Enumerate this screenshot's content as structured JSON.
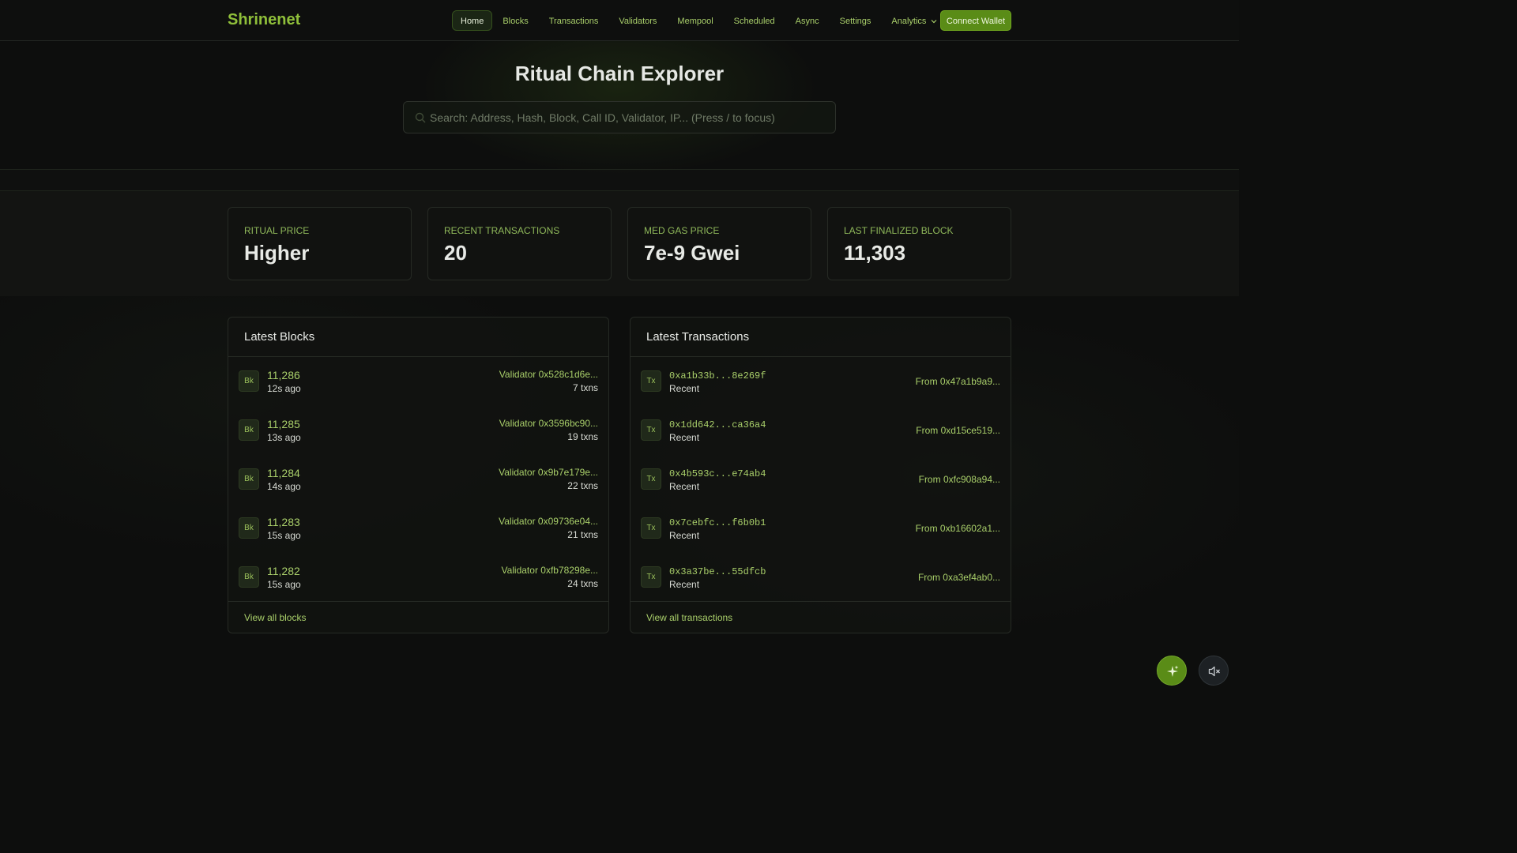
{
  "brand": "Shrinenet",
  "nav": {
    "links": [
      "Home",
      "Blocks",
      "Transactions",
      "Validators",
      "Mempool",
      "Scheduled",
      "Async",
      "Settings"
    ],
    "analytics": "Analytics",
    "connect_wallet": "Connect Wallet"
  },
  "hero": {
    "title": "Ritual Chain Explorer",
    "search_placeholder": "Search: Address, Hash, Block, Call ID, Validator, IP... (Press / to focus)"
  },
  "stats": [
    {
      "label": "RITUAL PRICE",
      "value": "Higher"
    },
    {
      "label": "RECENT TRANSACTIONS",
      "value": "20"
    },
    {
      "label": "MED GAS PRICE",
      "value": "7e-9 Gwei"
    },
    {
      "label": "LAST FINALIZED BLOCK",
      "value": "11,303"
    }
  ],
  "latest_blocks": {
    "title": "Latest Blocks",
    "badge": "Bk",
    "rows": [
      {
        "number": "11,286",
        "age": "12s ago",
        "validator": "Validator 0x528c1d6e...",
        "txns": "7 txns"
      },
      {
        "number": "11,285",
        "age": "13s ago",
        "validator": "Validator 0x3596bc90...",
        "txns": "19 txns"
      },
      {
        "number": "11,284",
        "age": "14s ago",
        "validator": "Validator 0x9b7e179e...",
        "txns": "22 txns"
      },
      {
        "number": "11,283",
        "age": "15s ago",
        "validator": "Validator 0x09736e04...",
        "txns": "21 txns"
      },
      {
        "number": "11,282",
        "age": "15s ago",
        "validator": "Validator 0xfb78298e...",
        "txns": "24 txns"
      }
    ],
    "view_all": "View all blocks"
  },
  "latest_transactions": {
    "title": "Latest Transactions",
    "badge": "Tx",
    "rows": [
      {
        "hash": "0xa1b33b...8e269f",
        "status": "Recent",
        "from": "From 0x47a1b9a9..."
      },
      {
        "hash": "0x1dd642...ca36a4",
        "status": "Recent",
        "from": "From 0xd15ce519..."
      },
      {
        "hash": "0x4b593c...e74ab4",
        "status": "Recent",
        "from": "From 0xfc908a94..."
      },
      {
        "hash": "0x7cebfc...f6b0b1",
        "status": "Recent",
        "from": "From 0xb16602a1..."
      },
      {
        "hash": "0x3a37be...55dfcb",
        "status": "Recent",
        "from": "From 0xa3ef4ab0..."
      }
    ],
    "view_all": "View all transactions"
  },
  "fabs": {
    "sparkle_icon": "sparkle-icon",
    "mute_icon": "speaker-muted-icon"
  },
  "colors": {
    "accent": "#8fbf3a",
    "button": "#5a8c17",
    "background": "#0d0e0d"
  }
}
